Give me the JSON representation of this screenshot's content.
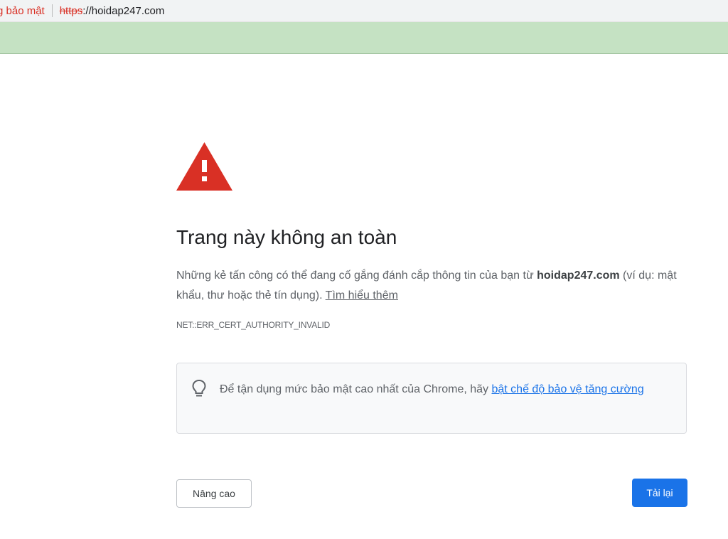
{
  "addressbar": {
    "security_label": "g bảo mật",
    "url_scheme": "https",
    "url_rest": "://hoidap247.com"
  },
  "page": {
    "title": "Trang này không an toàn",
    "desc_before": "Những kẻ tấn công có thể đang cố gắng đánh cắp thông tin của bạn từ ",
    "desc_host": "hoidap247.com",
    "desc_after": " (ví dụ: mật khẩu, thư hoặc thẻ tín dụng). ",
    "learn_more": "Tìm hiểu thêm",
    "error_code": "NET::ERR_CERT_AUTHORITY_INVALID"
  },
  "tip": {
    "text": "Để tận dụng mức bảo mật cao nhất của Chrome, hãy ",
    "link": "bật chế độ bảo vệ tăng cường"
  },
  "buttons": {
    "advanced": "Nâng cao",
    "reload": "Tải lại"
  },
  "icons": {
    "warning": "warning-triangle-icon",
    "tip": "lightbulb-icon"
  },
  "colors": {
    "danger": "#d93025",
    "primary": "#1a73e8",
    "banner": "#c5e2c3"
  }
}
